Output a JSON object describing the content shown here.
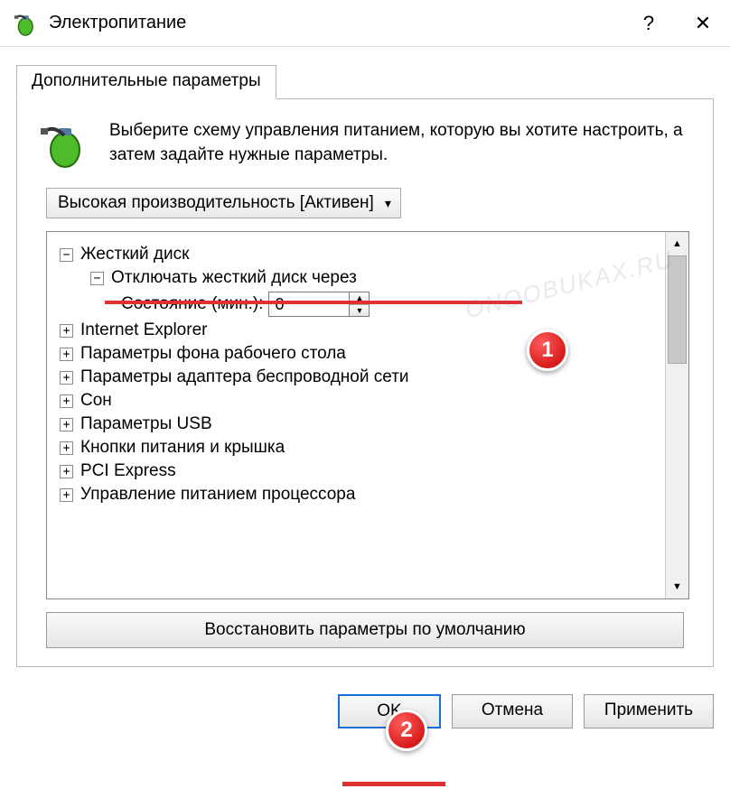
{
  "window": {
    "title": "Электропитание",
    "help": "?",
    "close": "✕"
  },
  "tab": {
    "label": "Дополнительные параметры"
  },
  "intro": "Выберите схему управления питанием, которую вы хотите настроить, а затем задайте нужные параметры.",
  "plan": {
    "label": "Высокая производительность [Активен]"
  },
  "tree": {
    "hard_disk": "Жесткий диск",
    "turn_off": "Отключать жесткий диск через",
    "state_label": "Состояние (мин.):",
    "state_value": "0",
    "ie": "Internet Explorer",
    "desktop_bg": "Параметры фона рабочего стола",
    "wifi": "Параметры адаптера беспроводной сети",
    "sleep": "Сон",
    "usb": "Параметры USB",
    "buttons_lid": "Кнопки питания и крышка",
    "pci": "PCI Express",
    "cpu": "Управление питанием процессора"
  },
  "restore": "Восстановить параметры по умолчанию",
  "footer": {
    "ok": "OK",
    "cancel": "Отмена",
    "apply": "Применить"
  },
  "callouts": {
    "one": "1",
    "two": "2"
  },
  "watermark": "ONOOBUKAX.RU"
}
